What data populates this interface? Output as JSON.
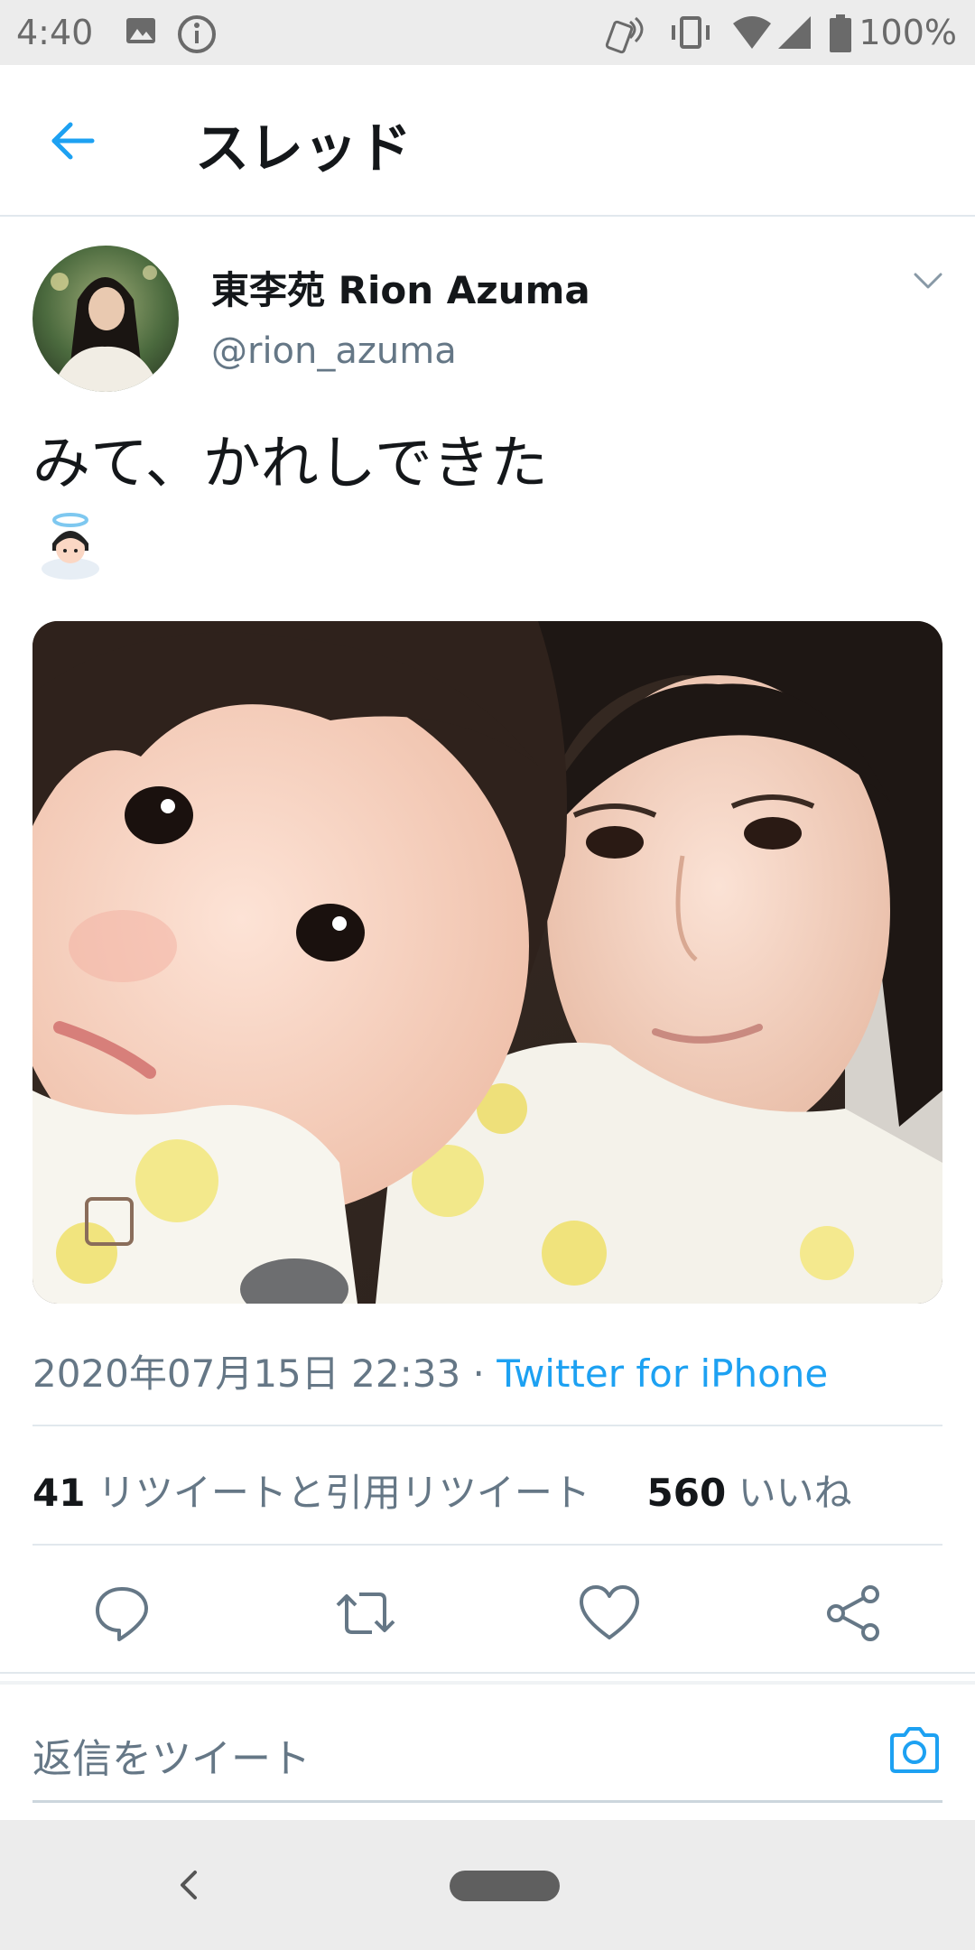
{
  "status_bar": {
    "time": "4:40",
    "battery": "100%",
    "icons": [
      "image-icon",
      "info-icon",
      "nfc-icon",
      "vibrate-icon",
      "wifi-icon",
      "signal-icon",
      "battery-icon"
    ]
  },
  "app_bar": {
    "title": "スレッド",
    "back_icon": "arrow-left-icon"
  },
  "tweet": {
    "display_name": "東李苑  Rion Azuma",
    "handle": "@rion_azuma",
    "text": "みて、かれしできた",
    "emoji": "angel-emoji",
    "date": "2020年07月15日 22:33",
    "separator": " · ",
    "source": "Twitter for iPhone",
    "retweets_count": "41",
    "retweets_label": "リツイートと引用リツイート",
    "likes_count": "560",
    "likes_label": "いいね"
  },
  "actions": [
    "reply-icon",
    "retweet-icon",
    "like-icon",
    "share-icon"
  ],
  "reply": {
    "placeholder": "返信をツイート"
  },
  "colors": {
    "accent": "#1da1f2",
    "text": "#14171a",
    "secondary": "#657786",
    "divider": "#e1e8ed"
  }
}
